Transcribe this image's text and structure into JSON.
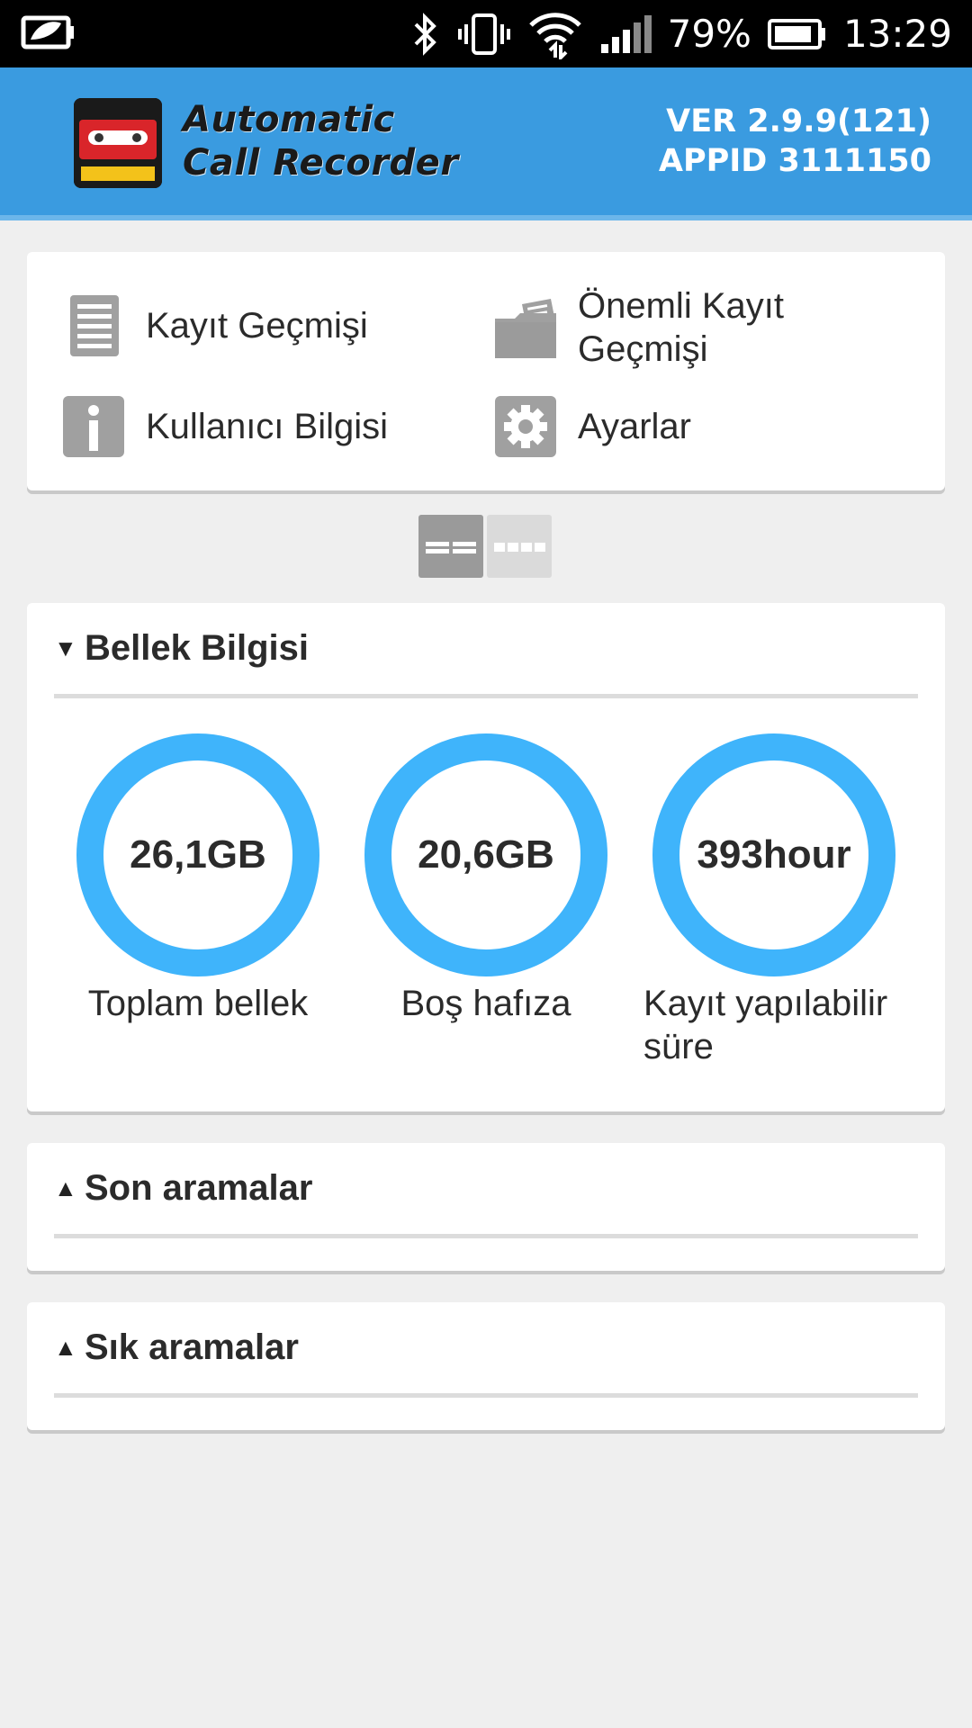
{
  "status_bar": {
    "battery_percent": "79%",
    "time": "13:29"
  },
  "header": {
    "app_name_line1": "Automatic",
    "app_name_line2": "Call Recorder",
    "logo_top_text": "Automatic",
    "logo_bottom_text": "Call Recorder",
    "version": "VER 2.9.9(121)",
    "app_id": "APPID 3111150"
  },
  "menu": {
    "items": [
      {
        "label": "Kayıt Geçmişi",
        "icon": "list-document-icon"
      },
      {
        "label": "Önemli Kayıt Geçmişi",
        "icon": "folder-icon"
      },
      {
        "label": "Kullanıcı Bilgisi",
        "icon": "info-icon"
      },
      {
        "label": "Ayarlar",
        "icon": "gear-icon"
      }
    ]
  },
  "memory": {
    "title": "Bellek Bilgisi",
    "gauges": [
      {
        "value": "26,1GB",
        "label": "Toplam bellek"
      },
      {
        "value": "20,6GB",
        "label": "Boş hafıza"
      },
      {
        "value": "393hour",
        "label": "Kayıt yapılabilir süre"
      }
    ]
  },
  "recent_calls": {
    "title": "Son aramalar"
  },
  "frequent_calls": {
    "title": "Sık aramalar"
  },
  "colors": {
    "header_bg": "#3a9be0",
    "ring": "#3fb4fb",
    "page_bg": "#efefef"
  }
}
